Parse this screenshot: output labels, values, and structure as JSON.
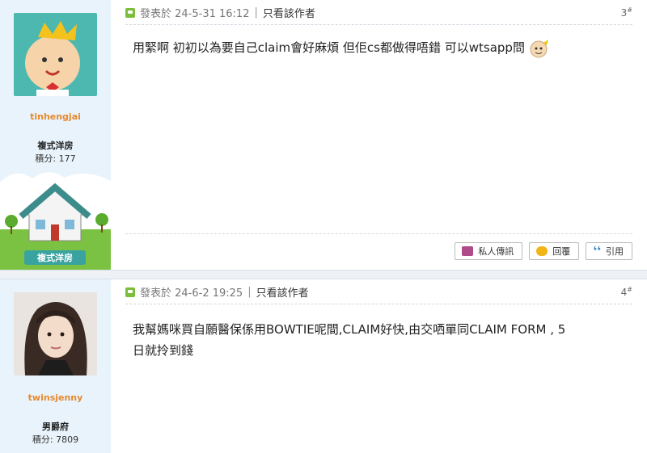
{
  "posts": [
    {
      "user": {
        "name": "tinhengjai",
        "rank": "複式洋房",
        "points": "積分: 177"
      },
      "meta": {
        "posted": "發表於 24-5-31 16:12",
        "separator": "|",
        "author_only": "只看該作者"
      },
      "floor": {
        "number": "3",
        "mark": "#"
      },
      "content": "用緊啊 初初以為要自己claim會好麻煩 但佢cs都做得唔錯 可以wtsapp問",
      "rank_badge": "複式洋房",
      "actions": {
        "pm": "私人傳訊",
        "reply": "回覆",
        "quote": "引用"
      }
    },
    {
      "user": {
        "name": "twinsjenny",
        "rank": "男爵府",
        "points": "積分: 7809"
      },
      "meta": {
        "posted": "發表於 24-6-2 19:25",
        "separator": "|",
        "author_only": "只看該作者"
      },
      "floor": {
        "number": "4",
        "mark": "#"
      },
      "content_line1": "我幫媽咪買自願醫保係用BOWTIE呢間,CLAIM好快,由交哂單同CLAIM FORM , 5",
      "content_line2": "日就拎到錢"
    }
  ],
  "colors": {
    "sidebar": "#e8f3fb",
    "username": "#e8892e",
    "post_icon": "#7cbd3a"
  }
}
